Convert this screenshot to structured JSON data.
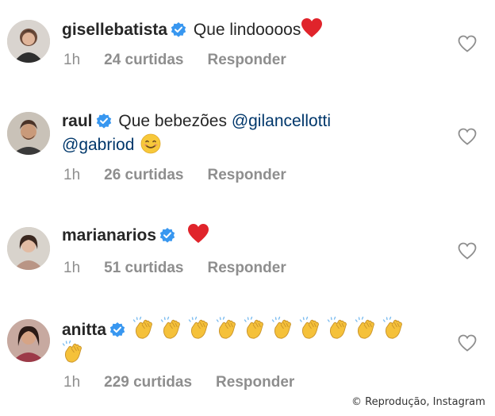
{
  "comments": [
    {
      "username": "gisellebatista",
      "text": "Que lindoooos",
      "time": "1h",
      "likes": "24 curtidas",
      "reply": "Responder"
    },
    {
      "username": "raul",
      "text": "Que bebezões",
      "mention1": "@gilancellotti",
      "mention2": "@gabriod",
      "time": "1h",
      "likes": "26 curtidas",
      "reply": "Responder"
    },
    {
      "username": "marianarios",
      "time": "1h",
      "likes": "51 curtidas",
      "reply": "Responder"
    },
    {
      "username": "anitta",
      "clap_count": 11,
      "time": "1h",
      "likes": "229 curtidas",
      "reply": "Responder"
    }
  ],
  "credit": "© Reprodução, Instagram",
  "colors": {
    "text": "#262626",
    "meta": "#8e8e8e",
    "verified": "#3897f0",
    "mention": "#00376b",
    "heart_emoji": "#e0242b"
  },
  "icons": {
    "verified": "verified-badge-icon",
    "like": "heart-outline-icon",
    "emoji_heart": "red-heart-emoji",
    "emoji_smile": "smiling-face-emoji",
    "emoji_clap": "clapping-hands-emoji"
  }
}
